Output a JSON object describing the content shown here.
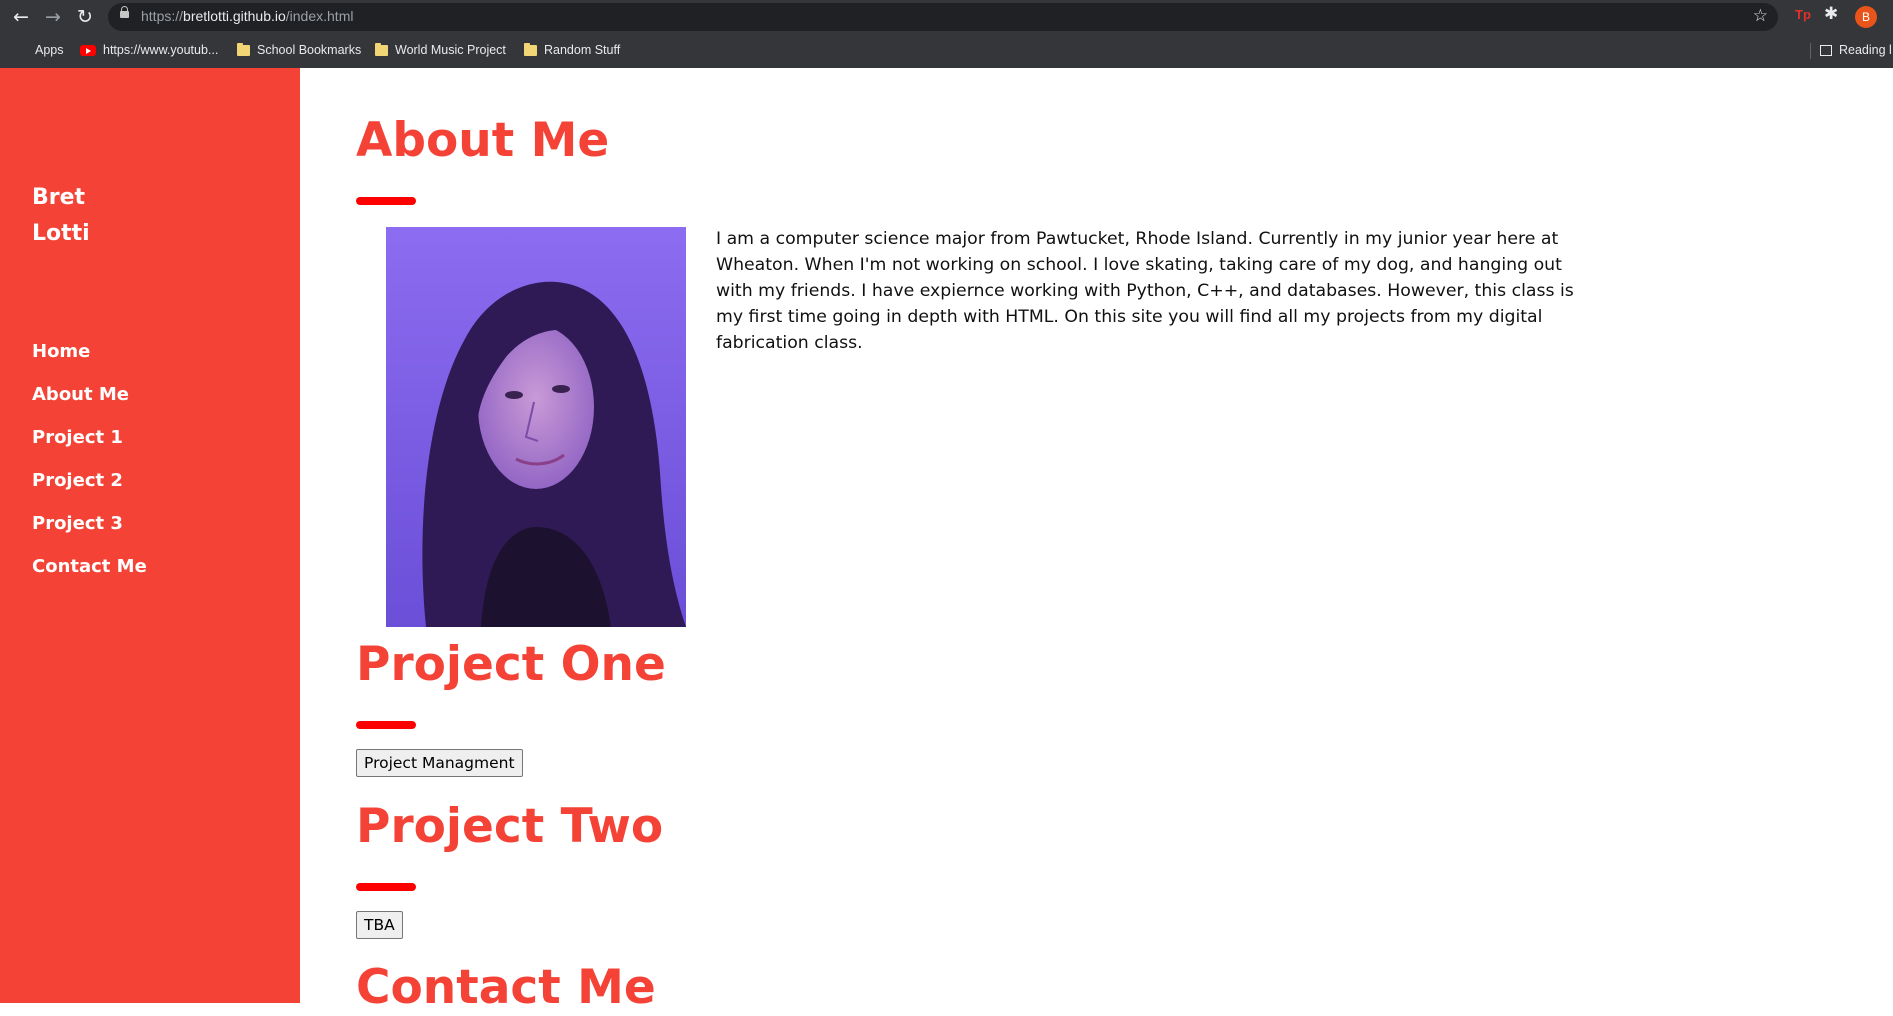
{
  "browser": {
    "url_scheme": "https://",
    "url_host": "bretlotti.github.io",
    "url_path": "/index.html",
    "extension_label": "Tp",
    "profile_initial": "B",
    "bookmarks": [
      {
        "label": "Apps",
        "icon": "apps-grid-icon"
      },
      {
        "label": "https://www.youtub...",
        "icon": "youtube-icon"
      },
      {
        "label": "School Bookmarks",
        "icon": "folder-icon"
      },
      {
        "label": "World Music Project",
        "icon": "folder-icon"
      },
      {
        "label": "Random Stuff",
        "icon": "folder-icon"
      }
    ],
    "reading_list_label": "Reading l"
  },
  "sidebar": {
    "brand_first": "Bret",
    "brand_last": "Lotti",
    "nav": [
      "Home",
      "About Me",
      "Project 1",
      "Project 2",
      "Project 3",
      "Contact Me"
    ]
  },
  "about": {
    "title": "About Me",
    "bio": "I am a computer science major from Pawtucket, Rhode Island. Currently in my junior year here at Wheaton. When I'm not working on school. I love skating, taking care of my dog, and hanging out with my friends. I have expiernce working with Python, C++, and databases. However, this class is my first time going in depth with HTML. On this site you will find all my projects from my digital fabrication class."
  },
  "project_one": {
    "title": "Project One",
    "button_label": "Project Managment"
  },
  "project_two": {
    "title": "Project Two",
    "button_label": "TBA"
  },
  "contact": {
    "title": "Contact Me"
  },
  "colors": {
    "sidebar_bg": "#f44336",
    "heading": "#f44336",
    "accent_bar": "#ff0000"
  }
}
